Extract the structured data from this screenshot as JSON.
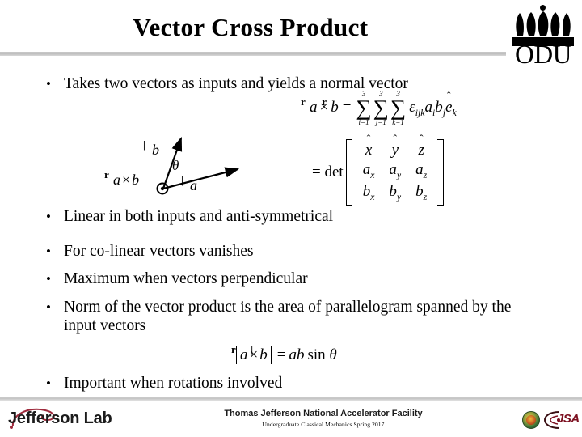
{
  "slide": {
    "title": "Vector Cross Product",
    "logo": {
      "odu_text": "ODU",
      "odu_name": "Old Dominion University crown logo"
    },
    "bullets": [
      {
        "marker": "•",
        "text": "Takes two vectors as inputs and yields a normal vector"
      },
      {
        "marker": "•",
        "text": "Linear in both inputs and anti-symmetrical"
      },
      {
        "marker": "•",
        "text": "For co-linear vectors vanishes"
      },
      {
        "marker": "•",
        "text": "Maximum when vectors perpendicular"
      },
      {
        "marker": "•",
        "text": "Norm of the vector product is the area of parallelogram spanned by the input vectors"
      },
      {
        "marker": "•",
        "text": "Important when rotations involved"
      }
    ],
    "equations": {
      "cross_sum": {
        "lhs_a": "a",
        "cross": "×",
        "lhs_b": "b",
        "equals": "=",
        "sigma": "∑",
        "upper_limit": "3",
        "lower_limits": [
          "i=1",
          "j=1",
          "k=1"
        ],
        "epsilon": "ε",
        "epsilon_indices": "ijk",
        "term_a": "a",
        "term_a_index": "i",
        "term_b": "b",
        "term_b_index": "j",
        "basis": "e",
        "basis_index": "k",
        "plain": "a⃗ × b⃗ = ∑(i=1..3) ∑(j=1..3) ∑(k=1..3) ε_ijk a_i b_j ê_k"
      },
      "determinant": {
        "equals": "=",
        "det_label": "det",
        "rows": [
          [
            "x",
            "y",
            "z"
          ],
          [
            "a",
            "a",
            "a"
          ],
          [
            "b",
            "b",
            "b"
          ]
        ],
        "row1_hat": true,
        "col_subscripts": [
          "x",
          "y",
          "z"
        ],
        "plain": "= det [ x̂ ŷ ẑ ; a_x a_y a_z ; b_x b_y b_z ]"
      },
      "norm": {
        "lhs_a": "a",
        "cross": "×",
        "lhs_b": "b",
        "equals": "=",
        "rhs": "ab sin",
        "theta": "θ",
        "plain": "|a⃗ × b⃗| = ab sin θ"
      }
    },
    "diagram": {
      "name": "vector-cross-product-diagram",
      "label_cross": "a",
      "label_cross_cross": "×",
      "label_cross_b": "b",
      "label_b": "b",
      "label_a": "a",
      "label_theta": "θ",
      "origin_symbol": "⊙",
      "origin_meaning": "out-of-page vector"
    },
    "footer": {
      "lab_logo_text": "Jefferson Lab",
      "facility": "Thomas Jefferson National Accelerator Facility",
      "course": "Undergraduate Classical Mechanics Spring 2017",
      "jsa_text": "JSA",
      "doe_seal_name": "department-of-energy-seal"
    },
    "colors": {
      "background": "#ffffff",
      "text": "#000000",
      "rule": "#c4c4c4",
      "jsa_red": "#7c1020",
      "jlab_swoosh": "#9e2a3c"
    }
  }
}
